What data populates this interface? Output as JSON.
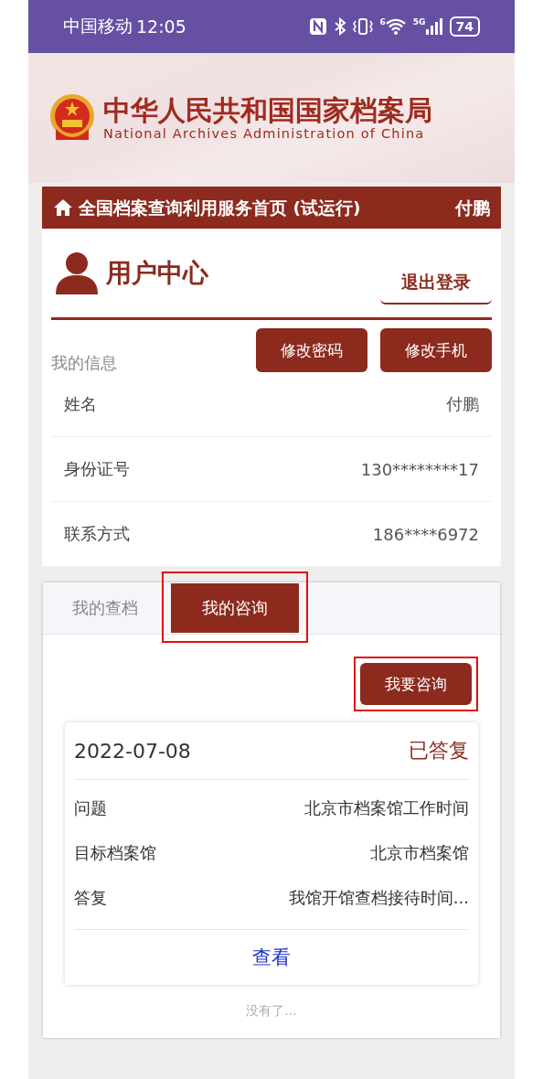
{
  "status_bar": {
    "carrier": "中国移动",
    "time": "12:05",
    "wifi_badge": "6",
    "network": "5G",
    "battery": "74"
  },
  "header": {
    "title": "中华人民共和国国家档案局",
    "subtitle": "National Archives Administration of China"
  },
  "nav": {
    "title": "全国档案查询利用服务首页 (试运行)",
    "user": "付鹏"
  },
  "user_center": {
    "title": "用户中心",
    "logout": "退出登录",
    "section": "我的信息",
    "buttons": [
      "修改密码",
      "修改手机"
    ],
    "fields": [
      {
        "label": "姓名",
        "value": "付鹏"
      },
      {
        "label": "身份证号",
        "value": "130********17"
      },
      {
        "label": "联系方式",
        "value": "186****6972"
      }
    ]
  },
  "tabs": [
    {
      "label": "我的查档",
      "selected": false,
      "highlighted": false
    },
    {
      "label": "我的咨询",
      "selected": true,
      "highlighted": true
    }
  ],
  "consult_button": {
    "label": "我要咨询",
    "highlighted": true
  },
  "consultations": [
    {
      "date": "2022-07-08",
      "status": "已答复",
      "rows": [
        {
          "label": "问题",
          "value": "北京市档案馆工作时间"
        },
        {
          "label": "目标档案馆",
          "value": "北京市档案馆"
        },
        {
          "label": "答复",
          "value": "我馆开馆查档接待时间..."
        }
      ],
      "action": "查看"
    }
  ],
  "end_note": "没有了..."
}
